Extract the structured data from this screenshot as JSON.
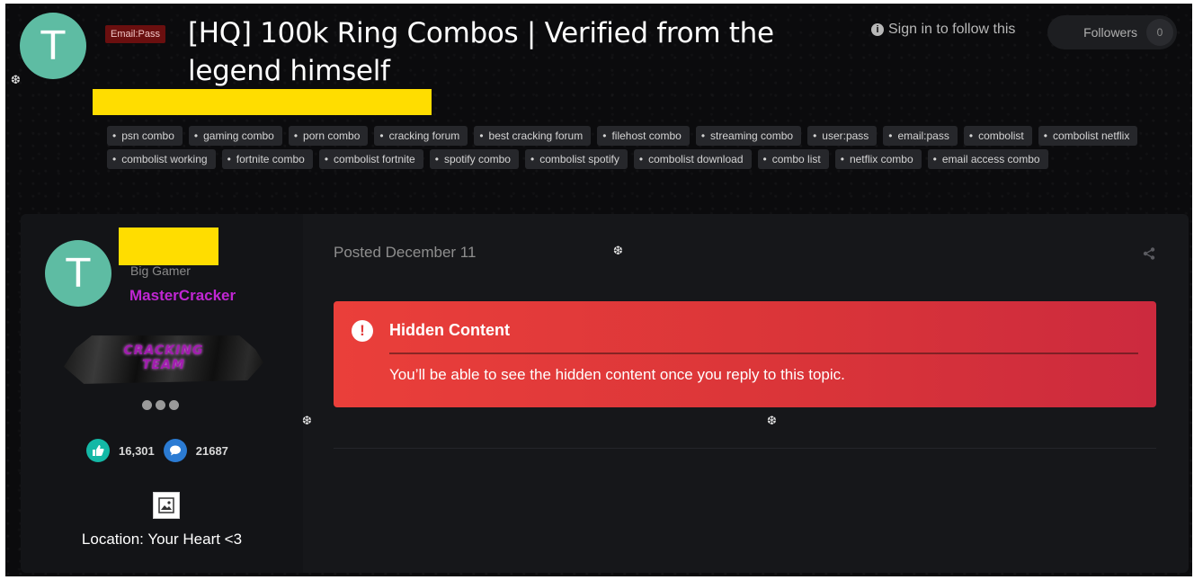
{
  "topic": {
    "avatar_letter": "T",
    "prefix": "Email:Pass",
    "title": "[HQ] 100k Ring Combos | Verified from the legend himself",
    "follow_text": "Sign in to follow this",
    "followers_label": "Followers",
    "followers_count": "0"
  },
  "tags": [
    "psn combo",
    "gaming combo",
    "porn combo",
    "cracking forum",
    "best cracking forum",
    "filehost combo",
    "streaming combo",
    "user:pass",
    "email:pass",
    "combolist",
    "combolist netflix",
    "combolist working",
    "fortnite combo",
    "combolist fortnite",
    "spotify combo",
    "combolist spotify",
    "combolist download",
    "combo list",
    "netflix combo",
    "email access combo"
  ],
  "author": {
    "avatar_letter": "T",
    "rank": "Big Gamer",
    "group": "MasterCracker",
    "banner_text_line1": "CRACKING",
    "banner_text_line2": "TEAM",
    "reputation": "16,301",
    "posts": "21687",
    "location": "Location: Your Heart <3"
  },
  "post": {
    "posted": "Posted December 11",
    "hidden_title": "Hidden Content",
    "hidden_message": "You’ll be able to see the hidden content once you reply to this topic."
  },
  "icons": {
    "snowflake": "❆",
    "info": "i",
    "alert": "!"
  },
  "colors": {
    "avatar": "#5ebca3",
    "group": "#c026d3",
    "hidden_box": "#e13a3a",
    "prefix_badge": "#6a0f0f"
  }
}
